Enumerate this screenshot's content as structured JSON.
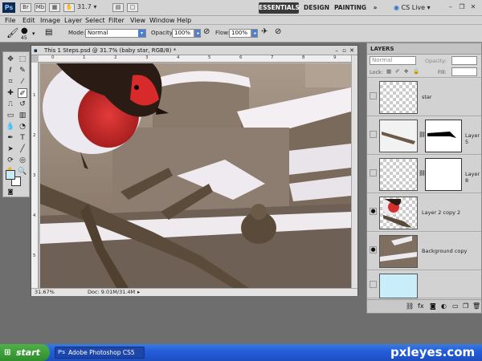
{
  "app": {
    "logo": "Ps",
    "zoom": "31.7"
  },
  "workspaces": {
    "essentials": "ESSENTIALS",
    "design": "DESIGN",
    "painting": "PAINTING",
    "more": "»",
    "cs_live": "CS Live"
  },
  "menu": [
    "File",
    "Edit",
    "Image",
    "Layer",
    "Select",
    "Filter",
    "View",
    "Window",
    "Help"
  ],
  "options": {
    "brush_size": "45",
    "mode_label": "Mode:",
    "mode_value": "Normal",
    "opacity_label": "Opacity:",
    "opacity_value": "100%",
    "flow_label": "Flow:",
    "flow_value": "100%"
  },
  "document": {
    "title": "This 1 Steps.psd @ 31.7% (baby star, RGB/8) *",
    "zoom_status": "31.67%",
    "doc_size": "Doc: 9.01M/31.4M",
    "ruler_top": [
      "0",
      "1",
      "2",
      "3",
      "4",
      "5",
      "6",
      "7",
      "8",
      "9"
    ],
    "ruler_left": [
      "1",
      "2",
      "3",
      "4",
      "5"
    ]
  },
  "layers_panel": {
    "title": "LAYERS",
    "blend_mode": "Normal",
    "opacity_label": "Opacity:",
    "lock_label": "Lock:",
    "fill_label": "Fill:",
    "layers": [
      {
        "name": "star",
        "visible": false
      },
      {
        "name": "Layer 5",
        "visible": false
      },
      {
        "name": "Layer 8",
        "visible": false
      },
      {
        "name": "Layer 2 copy 2",
        "visible": true
      },
      {
        "name": "Background copy",
        "visible": true
      },
      {
        "name": "",
        "visible": false
      }
    ]
  },
  "taskbar": {
    "start_label": "start",
    "task_label": "Adobe Photoshop CS5"
  },
  "watermark": "pxleyes.com",
  "colors": {
    "foreground": "#c7ecf7",
    "background": "#ffffff",
    "active_workspace": "#3a3a3a"
  }
}
